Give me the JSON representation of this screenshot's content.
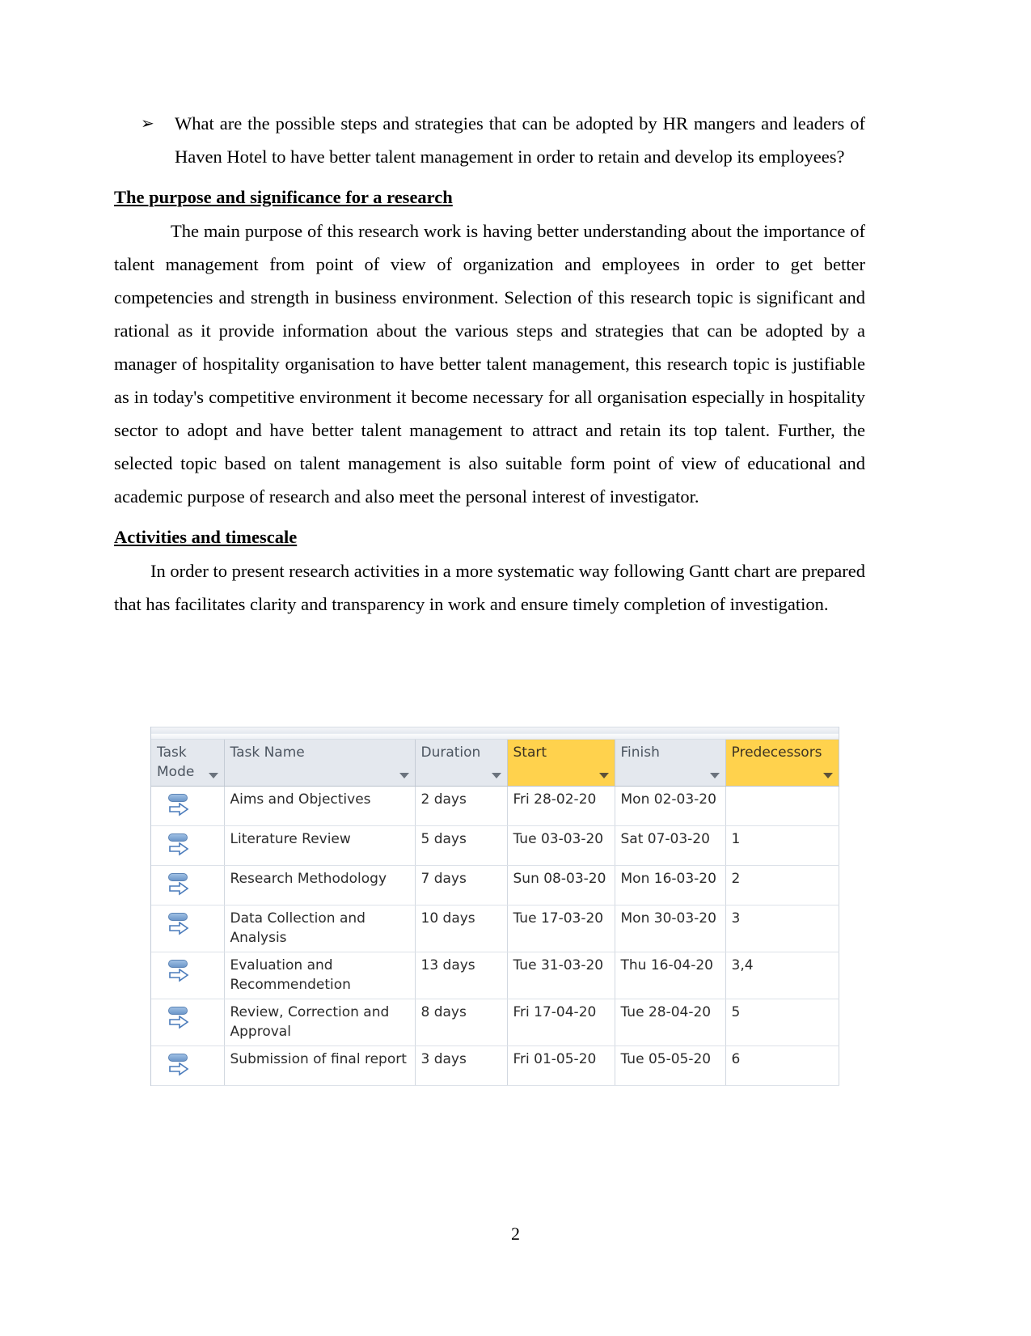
{
  "document": {
    "bullet": {
      "marker": "➢",
      "text": "What are the possible steps and strategies that can be adopted by HR mangers and leaders of Haven Hotel to have better talent management in order to retain and develop its employees?"
    },
    "headings": {
      "purpose": "The purpose and significance for a research",
      "activities": "Activities and timescale "
    },
    "paragraphs": {
      "purpose_body": "The main purpose of this research work is having better understanding about the importance of talent management from point of view of organization and employees in order to get better competencies and strength in business environment. Selection of this research topic is significant and rational as it provide information about the various steps and strategies that can be adopted by a manager of hospitality organisation to have better talent management, this research topic is justifiable as in today's competitive environment it become necessary for all organisation especially in hospitality sector to adopt and have better talent management to attract and retain its top talent. Further, the selected topic based on talent management is also suitable form point of view of educational and academic purpose of research and also meet the personal interest of investigator.",
      "activities_body": "In order to present research activities in a more systematic way following Gantt chart are prepared that has facilitates clarity and transparency in work and ensure timely completion of investigation."
    },
    "page_number": "2"
  },
  "gantt_table": {
    "columns": [
      {
        "label": "Task Mode",
        "highlight": "none",
        "filter": true
      },
      {
        "label": "Task Name",
        "highlight": "none",
        "filter": true
      },
      {
        "label": "Duration",
        "highlight": "none",
        "filter": true
      },
      {
        "label": "Start",
        "highlight": "yellow",
        "filter": true
      },
      {
        "label": "Finish",
        "highlight": "none",
        "filter": true
      },
      {
        "label": "Predecessors",
        "highlight": "yellow",
        "filter": true
      }
    ],
    "rows": [
      {
        "mode_icon": "manually-scheduled-icon",
        "name": "Aims and Objectives",
        "duration": "2 days",
        "start": "Fri 28-02-20",
        "finish": "Mon 02-03-20",
        "predecessors": ""
      },
      {
        "mode_icon": "manually-scheduled-icon",
        "name": "Literature Review",
        "duration": "5 days",
        "start": "Tue 03-03-20",
        "finish": "Sat 07-03-20",
        "predecessors": "1"
      },
      {
        "mode_icon": "manually-scheduled-icon",
        "name": "Research Methodology",
        "duration": "7 days",
        "start": "Sun 08-03-20",
        "finish": "Mon 16-03-20",
        "predecessors": "2"
      },
      {
        "mode_icon": "manually-scheduled-icon",
        "name": "Data Collection and Analysis",
        "duration": "10 days",
        "start": "Tue 17-03-20",
        "finish": "Mon 30-03-20",
        "predecessors": "3"
      },
      {
        "mode_icon": "manually-scheduled-icon",
        "name": "Evaluation and Recommendetion",
        "duration": "13 days",
        "start": "Tue 31-03-20",
        "finish": "Thu 16-04-20",
        "predecessors": "3,4"
      },
      {
        "mode_icon": "manually-scheduled-icon",
        "name": "Review, Correction and Approval",
        "duration": "8 days",
        "start": "Fri 17-04-20",
        "finish": "Tue 28-04-20",
        "predecessors": "5"
      },
      {
        "mode_icon": "manually-scheduled-icon",
        "name": "Submission of final report",
        "duration": "3 days",
        "start": "Fri 01-05-20",
        "finish": "Tue 05-05-20",
        "predecessors": "6",
        "selected_cells": [
          "duration",
          "finish"
        ]
      }
    ],
    "colors": {
      "header_background": "#e4e8ee",
      "header_highlight": "#ffd24d",
      "selected_cell": "#e2ecf7",
      "grid_line": "#d2d8e0",
      "icon_blue": "#6d97c9"
    }
  }
}
